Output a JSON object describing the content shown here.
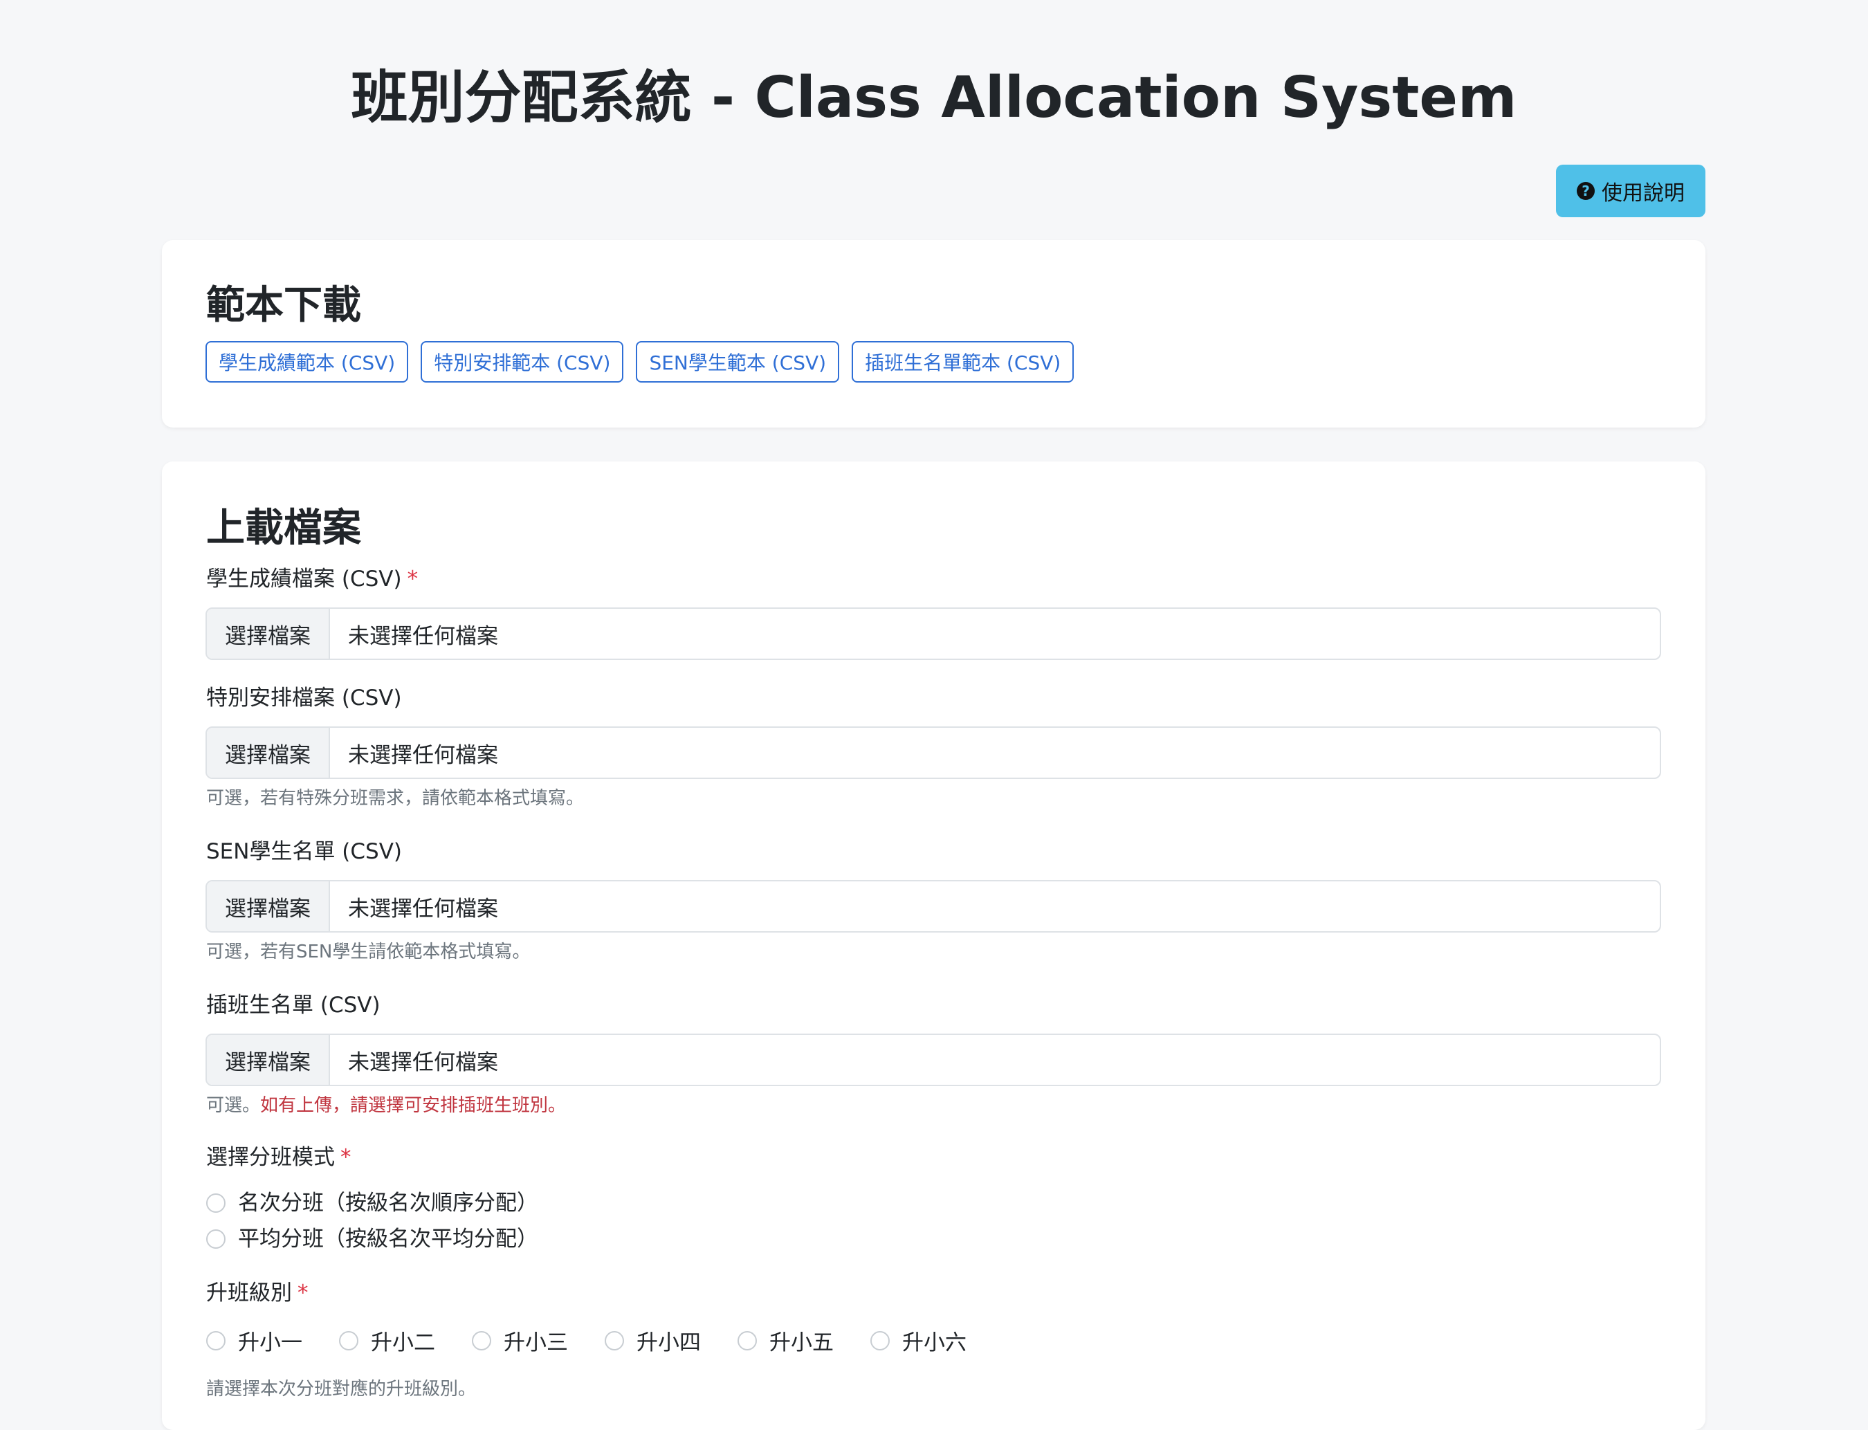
{
  "header": {
    "title": "班別分配系統 - Class Allocation System",
    "help_button": "使用說明"
  },
  "templates": {
    "heading": "範本下載",
    "buttons": [
      "學生成績範本 (CSV)",
      "特別安排範本 (CSV)",
      "SEN學生範本 (CSV)",
      "插班生名單範本 (CSV)"
    ]
  },
  "upload": {
    "heading": "上載檔案",
    "choose_label": "選擇檔案",
    "no_file": "未選擇任何檔案",
    "required_mark": "*",
    "scores": {
      "label": "學生成績檔案 (CSV)"
    },
    "special": {
      "label": "特別安排檔案 (CSV)",
      "help": "可選，若有特殊分班需求，請依範本格式填寫。"
    },
    "sen": {
      "label": "SEN學生名單 (CSV)",
      "help": "可選，若有SEN學生請依範本格式填寫。"
    },
    "transfer": {
      "label": "插班生名單 (CSV)",
      "help_prefix": "可選。",
      "help_warning": "如有上傳，請選擇可安排插班生班別。"
    },
    "mode": {
      "label": "選擇分班模式",
      "options": [
        "名次分班（按級名次順序分配）",
        "平均分班（按級名次平均分配）"
      ]
    },
    "grade": {
      "label": "升班級別",
      "options": [
        "升小一",
        "升小二",
        "升小三",
        "升小四",
        "升小五",
        "升小六"
      ],
      "help": "請選擇本次分班對應的升班級別。"
    }
  },
  "colors": {
    "background": "#f6f7f9",
    "help_button": "#4fc0e8",
    "outline_primary": "#2f6fd6",
    "required": "#dc3545",
    "warning_text": "#c0353f"
  }
}
